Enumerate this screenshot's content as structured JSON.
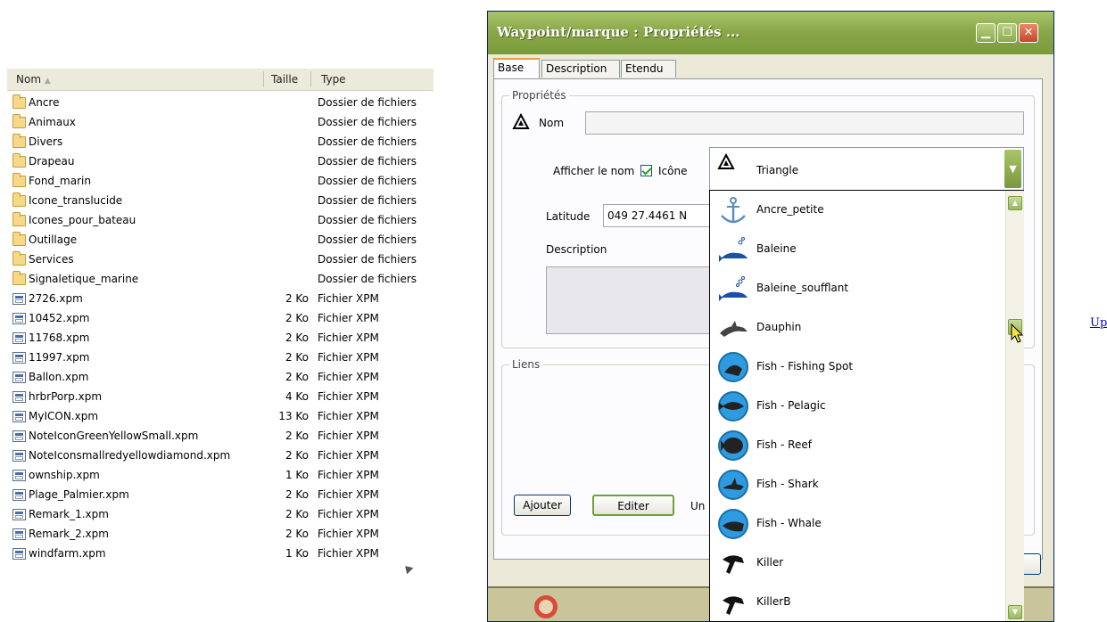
{
  "explorer": {
    "columns": {
      "name": "Nom",
      "size": "Taille",
      "type": "Type"
    },
    "rows": [
      {
        "name": "Ancre",
        "size": "",
        "type": "Dossier de fichiers",
        "kind": "folder-icon"
      },
      {
        "name": "Animaux",
        "size": "",
        "type": "Dossier de fichiers",
        "kind": "folder-icon"
      },
      {
        "name": "Divers",
        "size": "",
        "type": "Dossier de fichiers",
        "kind": "folder-icon"
      },
      {
        "name": "Drapeau",
        "size": "",
        "type": "Dossier de fichiers",
        "kind": "folder-icon"
      },
      {
        "name": "Fond_marin",
        "size": "",
        "type": "Dossier de fichiers",
        "kind": "folder-icon"
      },
      {
        "name": "Icone_translucide",
        "size": "",
        "type": "Dossier de fichiers",
        "kind": "folder-icon"
      },
      {
        "name": "Icones_pour_bateau",
        "size": "",
        "type": "Dossier de fichiers",
        "kind": "folder-icon"
      },
      {
        "name": "Outillage",
        "size": "",
        "type": "Dossier de fichiers",
        "kind": "folder-icon"
      },
      {
        "name": "Services",
        "size": "",
        "type": "Dossier de fichiers",
        "kind": "folder-icon"
      },
      {
        "name": "Signaletique_marine",
        "size": "",
        "type": "Dossier de fichiers",
        "kind": "folder-icon"
      },
      {
        "name": "2726.xpm",
        "size": "2 Ko",
        "type": "Fichier XPM",
        "kind": "xpm-file-icon"
      },
      {
        "name": "10452.xpm",
        "size": "2 Ko",
        "type": "Fichier XPM",
        "kind": "xpm-file-icon"
      },
      {
        "name": "11768.xpm",
        "size": "2 Ko",
        "type": "Fichier XPM",
        "kind": "xpm-file-icon"
      },
      {
        "name": "11997.xpm",
        "size": "2 Ko",
        "type": "Fichier XPM",
        "kind": "xpm-file-icon"
      },
      {
        "name": "Ballon.xpm",
        "size": "2 Ko",
        "type": "Fichier XPM",
        "kind": "xpm-file-icon"
      },
      {
        "name": "hrbrPorp.xpm",
        "size": "4 Ko",
        "type": "Fichier XPM",
        "kind": "xpm-file-icon"
      },
      {
        "name": "MyICON.xpm",
        "size": "13 Ko",
        "type": "Fichier XPM",
        "kind": "xpm-file-icon"
      },
      {
        "name": "NoteIconGreenYellowSmall.xpm",
        "size": "2 Ko",
        "type": "Fichier XPM",
        "kind": "xpm-file-icon"
      },
      {
        "name": "NoteIconsmallredyellowdiamond.xpm",
        "size": "2 Ko",
        "type": "Fichier XPM",
        "kind": "xpm-file-icon"
      },
      {
        "name": "ownship.xpm",
        "size": "1 Ko",
        "type": "Fichier XPM",
        "kind": "xpm-file-icon"
      },
      {
        "name": "Plage_Palmier.xpm",
        "size": "2 Ko",
        "type": "Fichier XPM",
        "kind": "xpm-file-icon"
      },
      {
        "name": "Remark_1.xpm",
        "size": "2 Ko",
        "type": "Fichier XPM",
        "kind": "xpm-file-icon"
      },
      {
        "name": "Remark_2.xpm",
        "size": "2 Ko",
        "type": "Fichier XPM",
        "kind": "xpm-file-icon"
      },
      {
        "name": "windfarm.xpm",
        "size": "1 Ko",
        "type": "Fichier XPM",
        "kind": "xpm-file-icon"
      }
    ]
  },
  "dialog": {
    "title": "Waypoint/marque : Propriétés ...",
    "tabs": [
      "Base",
      "Description",
      "Etendu"
    ],
    "group_properties": "Propriétés",
    "name_label": "Nom",
    "name_value": "",
    "show_name_label": "Afficher le nom",
    "show_name_checked": true,
    "icon_label": "Icône",
    "icon_selected": "Triangle",
    "latitude_label": "Latitude",
    "latitude_value": "049 27.4461 N",
    "description_label": "Description",
    "group_links": "Liens",
    "add_button": "Ajouter",
    "edit_button": "Editer",
    "extra_text": "Un"
  },
  "dropdown_options": [
    {
      "label": "Ancre_petite",
      "icon": "anchor-icon"
    },
    {
      "label": "Baleine",
      "icon": "whale-icon"
    },
    {
      "label": "Baleine_soufflant",
      "icon": "whale-spouting-icon"
    },
    {
      "label": "Dauphin",
      "icon": "dolphin-icon"
    },
    {
      "label": "Fish - Fishing Spot",
      "icon": "fish-fishing-spot-icon"
    },
    {
      "label": "Fish - Pelagic",
      "icon": "fish-pelagic-icon"
    },
    {
      "label": "Fish - Reef",
      "icon": "fish-reef-icon"
    },
    {
      "label": "Fish - Shark",
      "icon": "fish-shark-icon"
    },
    {
      "label": "Fish - Whale",
      "icon": "fish-whale-icon"
    },
    {
      "label": "Killer",
      "icon": "killer-whale-icon"
    },
    {
      "label": "KillerB",
      "icon": "killer-whale-b-icon"
    }
  ],
  "link_text": "Up",
  "colors": {
    "titlebar": "#8aa84a",
    "close": "#c8452a",
    "link": "#0000cc",
    "check": "#21a121"
  }
}
